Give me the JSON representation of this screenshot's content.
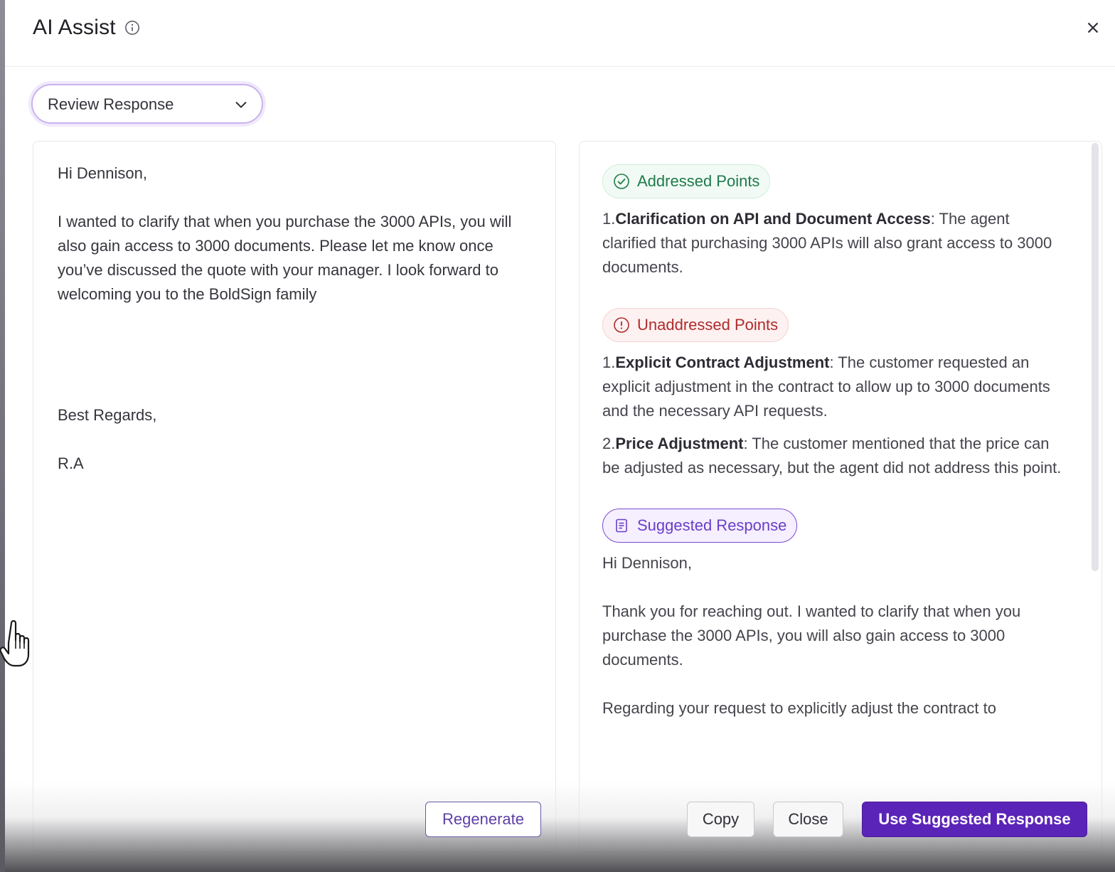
{
  "header": {
    "title": "AI Assist"
  },
  "mode_select": {
    "selected": "Review Response"
  },
  "editor": {
    "greeting": "Hi Dennison,",
    "body": "I wanted to clarify that when you purchase the 3000 APIs, you will also gain access to 3000 documents. Please let me know once you’ve discussed the quote with your manager. I look forward to welcoming you to the BoldSign family",
    "closing": "Best Regards,",
    "signature": "R.A"
  },
  "review": {
    "addressed_label": "Addressed Points",
    "addressed": [
      {
        "num": "1.",
        "title": "Clarification on API and Document Access",
        "text": ": The agent clarified that purchasing 3000 APIs will also grant access to 3000 documents."
      }
    ],
    "unaddressed_label": "Unaddressed Points",
    "unaddressed": [
      {
        "num": "1.",
        "title": "Explicit Contract Adjustment",
        "text": ": The customer requested an explicit adjustment in the contract to allow up to 3000 documents and the necessary API requests."
      },
      {
        "num": "2.",
        "title": "Price Adjustment",
        "text": ": The customer mentioned that the price can be adjusted as necessary, but the agent did not address this point."
      }
    ],
    "suggested_label": "Suggested Response",
    "suggested": {
      "greeting": "Hi Dennison,",
      "para1": "Thank you for reaching out. I wanted to clarify that when you purchase the 3000 APIs, you will also gain access to 3000 documents.",
      "para2": "Regarding your request to explicitly adjust the contract to"
    }
  },
  "buttons": {
    "regenerate": "Regenerate",
    "copy": "Copy",
    "close": "Close",
    "use_suggested": "Use Suggested Response"
  },
  "colors": {
    "accent": "#5b24b8",
    "addressed": "#1f7a4a",
    "unaddressed": "#b02b2b",
    "suggested": "#6a3ec8"
  }
}
